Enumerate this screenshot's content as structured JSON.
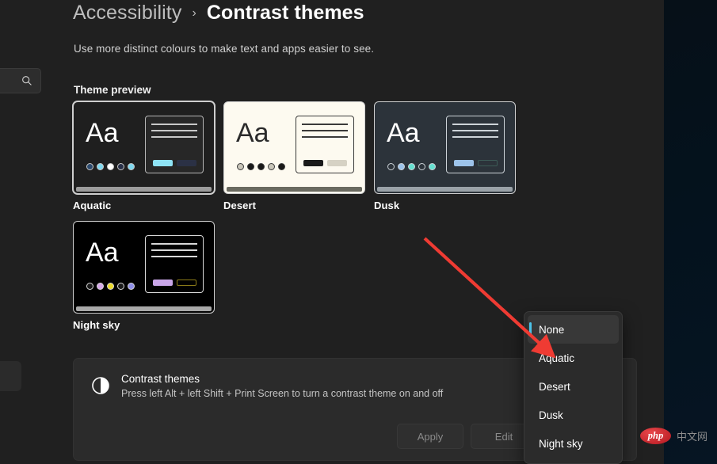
{
  "header": {
    "breadcrumb_parent": "Accessibility",
    "breadcrumb_separator": "›",
    "breadcrumb_current": "Contrast themes",
    "subtitle": "Use more distinct colours to make text and apps easier to see."
  },
  "search": {
    "placeholder": "",
    "icon": "search-icon"
  },
  "theme_preview": {
    "label": "Theme preview",
    "sample_text": "Aa",
    "cards": [
      {
        "name": "Aquatic",
        "selected": true,
        "bg": "#1f1f1f",
        "text": "#ffffff",
        "border": "#cfcfcf",
        "line": "#c8c8c8",
        "mini_bg": "#272727",
        "mini_border": "#b6b6b6",
        "accent": "#8ee3f5",
        "accent2": "#2b3145",
        "taskbar": "#9c9c9c",
        "dots": [
          "#2c4a6e",
          "#7fd8ef",
          "#ffffff",
          "#283048",
          "#7fd8ef"
        ]
      },
      {
        "name": "Desert",
        "selected": false,
        "bg": "#fdfaf0",
        "text": "#2b2b2b",
        "border": "#cfcfcf",
        "line": "#3a3a3a",
        "mini_bg": "#fdfaf0",
        "mini_border": "#3a3a3a",
        "accent": "#1a1a1a",
        "accent2": "#d6d2c4",
        "taskbar": "#6a6a60",
        "dots": [
          "#c9c6ba",
          "#191919",
          "#191919",
          "#c9c6ba",
          "#191919"
        ]
      },
      {
        "name": "Dusk",
        "selected": false,
        "bg": "#2c333a",
        "text": "#ffffff",
        "border": "#cfcfcf",
        "line": "#cdd3d8",
        "mini_bg": "#2c333a",
        "mini_border": "#cdd3d8",
        "accent": "#9cc3ea",
        "accent2": "#3c5b56",
        "taskbar": "#9aa2a8",
        "dots": [
          "#2c333a",
          "#9cc3ea",
          "#66e0d0",
          "#2c333a",
          "#66e0d0"
        ]
      },
      {
        "name": "Night sky",
        "selected": false,
        "bg": "#000000",
        "text": "#ffffff",
        "border": "#cfcfcf",
        "line": "#d8d8d8",
        "mini_bg": "#000000",
        "mini_border": "#d8d8d8",
        "accent": "#c9a6e8",
        "accent2": "#8a7a18",
        "taskbar": "#a8a8a8",
        "dots": [
          "#1a1a1a",
          "#d5a8ea",
          "#ead92a",
          "#1a1a1a",
          "#8f8fe8"
        ]
      }
    ]
  },
  "settings_panel": {
    "icon": "contrast-icon",
    "title": "Contrast themes",
    "description": "Press left Alt + left Shift + Print Screen to turn a contrast theme on and off",
    "apply_label": "Apply",
    "edit_label": "Edit"
  },
  "dropdown": {
    "selected": "None",
    "accent": "#4cc2e8",
    "items": [
      {
        "label": "None",
        "active": true
      },
      {
        "label": "Aquatic",
        "active": false
      },
      {
        "label": "Desert",
        "active": false
      },
      {
        "label": "Dusk",
        "active": false
      },
      {
        "label": "Night sky",
        "active": false
      }
    ]
  },
  "annotation": {
    "arrow_color": "#ef3b33"
  },
  "watermark": {
    "logo_text": "php",
    "text": "中文网"
  }
}
